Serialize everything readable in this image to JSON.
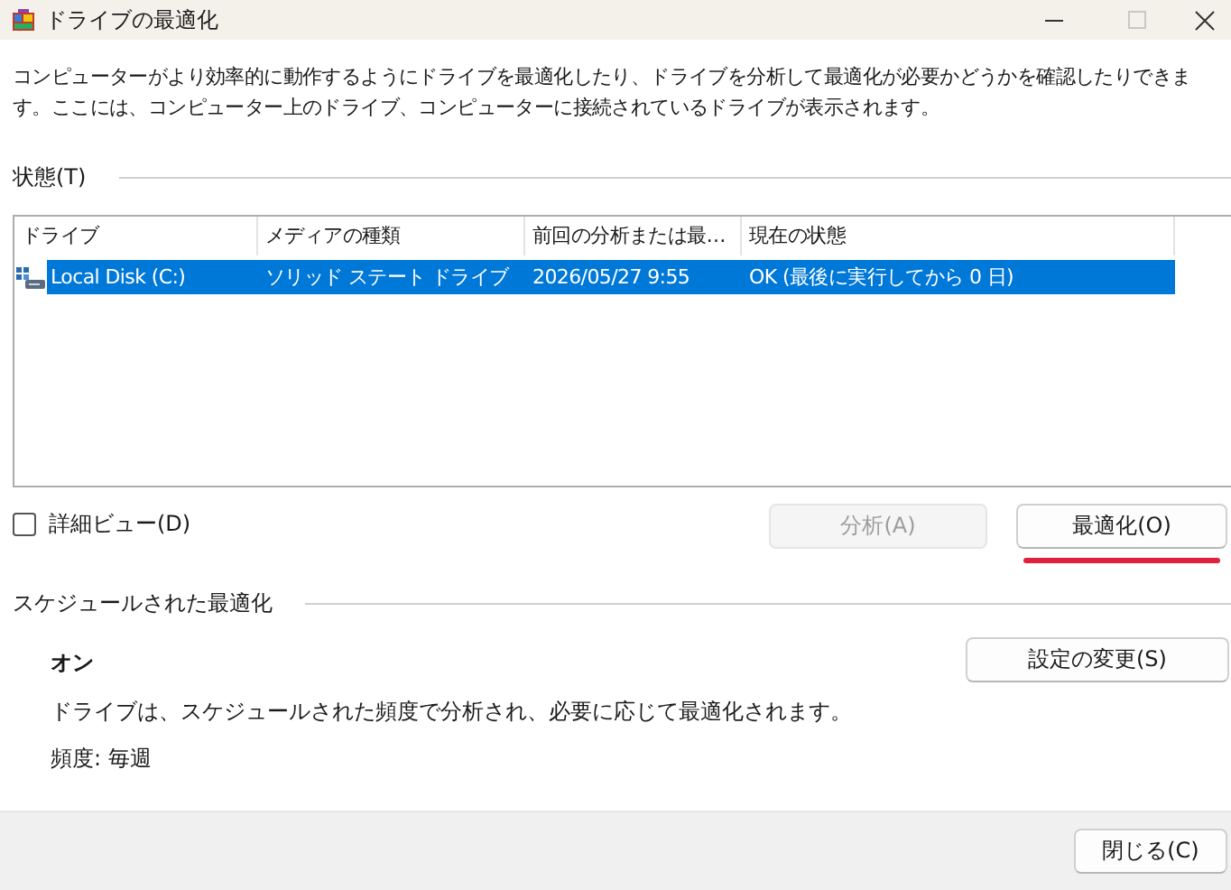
{
  "window": {
    "title": "ドライブの最適化"
  },
  "description": "コンピューターがより効率的に動作するようにドライブを最適化したり、ドライブを分析して最適化が必要かどうかを確認したりできます。ここには、コンピューター上のドライブ、コンピューターに接続されているドライブが表示されます。",
  "status_section": {
    "label": "状態(T)"
  },
  "table": {
    "columns": [
      "ドライブ",
      "メディアの種類",
      "前回の分析または最…",
      "現在の状態"
    ],
    "rows": [
      {
        "cells": [
          "Local Disk (C:)",
          "ソリッド ステート ドライブ",
          "2026/05/27 9:55",
          "OK (最後に実行してから 0 日)"
        ],
        "selected": true
      }
    ]
  },
  "detail_view": {
    "label": "詳細ビュー(D)",
    "checked": false
  },
  "actions": [
    {
      "label": "分析(A)",
      "disabled": true,
      "highlighted": false
    },
    {
      "label": "最適化(O)",
      "disabled": false,
      "highlighted": true
    }
  ],
  "schedule": {
    "heading": "スケジュールされた最適化",
    "state": "オン",
    "description": "ドライブは、スケジュールされた頻度で分析され、必要に応じて最適化されます。",
    "frequency": "頻度: 毎週",
    "button": "設定の変更(S)"
  },
  "footer": {
    "button": "閉じる(C)"
  }
}
